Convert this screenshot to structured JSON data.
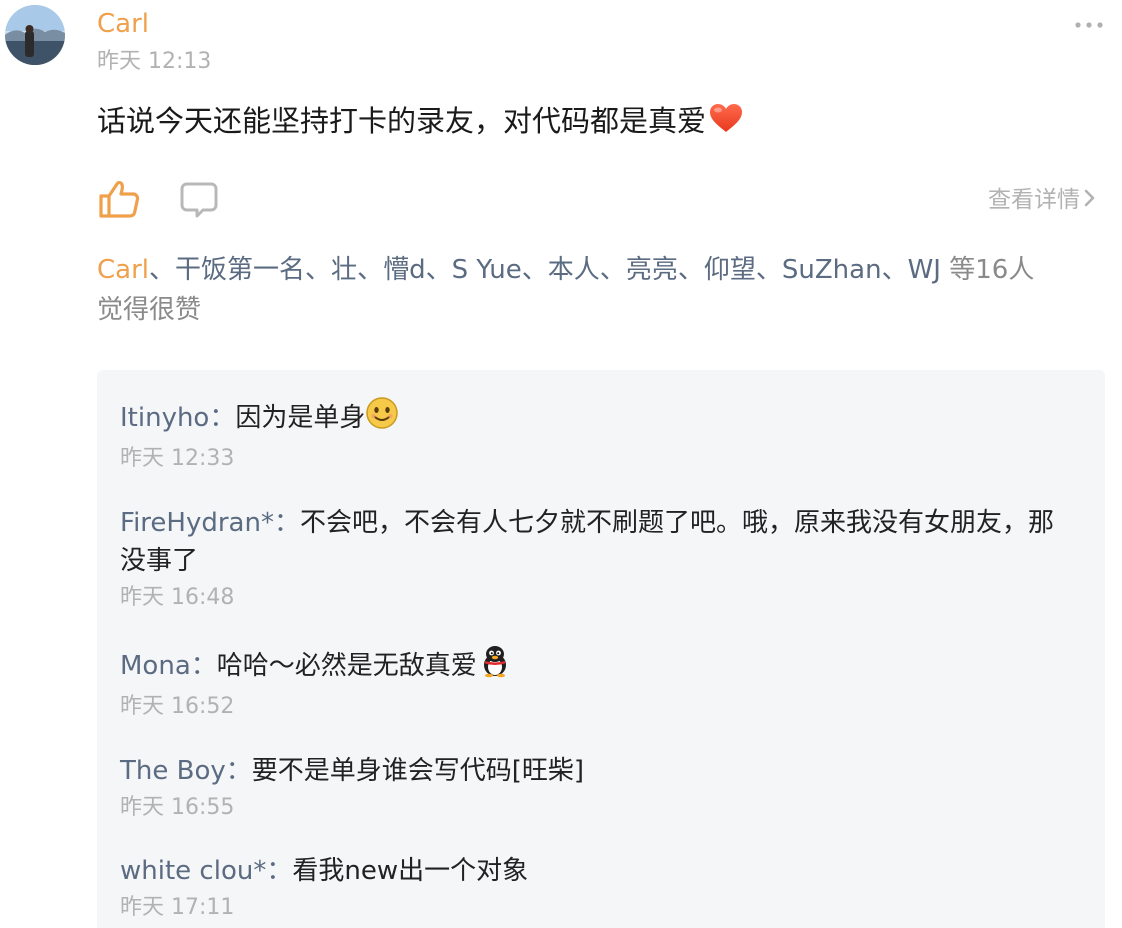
{
  "post": {
    "author": "Carl",
    "time": "昨天 12:13",
    "content": "话说今天还能坚持打卡的录友，对代码都是真爱",
    "view_detail": "查看详情"
  },
  "likes": {
    "first": "Carl",
    "names": [
      "干饭第一名",
      "壮",
      "懵d",
      "S Yue",
      "本人",
      "亮亮",
      "仰望",
      "SuZhan",
      "WJ"
    ],
    "separator": "、",
    "count_text": " 等16人",
    "suffix": "觉得很赞"
  },
  "comments": [
    {
      "name": "Itinyho",
      "colon": "：",
      "text": "因为是单身",
      "time": "昨天 12:33",
      "emoji": "smile-emoji"
    },
    {
      "name": "FireHydran*",
      "colon": "：",
      "text": "不会吧，不会有人七夕就不刷题了吧。哦，原来我没有女朋友，那没事了",
      "time": "昨天 16:48"
    },
    {
      "name": "Mona",
      "colon": "：",
      "text": "哈哈～必然是无敌真爱",
      "time": "昨天 16:52",
      "emoji": "penguin-emoji"
    },
    {
      "name": "The Boy",
      "colon": "：",
      "text": "要不是单身谁会写代码[旺柴]",
      "time": "昨天 16:55"
    },
    {
      "name": "white clou*",
      "colon": "：",
      "text": "看我new出一个对象",
      "time": "昨天 17:11"
    }
  ],
  "icons": {
    "like": "thumbs-up-icon",
    "comment": "comment-bubble-icon",
    "more": "more-dots-icon",
    "chevron": "chevron-right-icon",
    "heart": "heart-emoji"
  },
  "colors": {
    "author_orange": "#f0a04b",
    "name_blue": "#5b6b82",
    "muted_gray": "#b2b2b2",
    "comments_bg": "#f5f6f8"
  }
}
